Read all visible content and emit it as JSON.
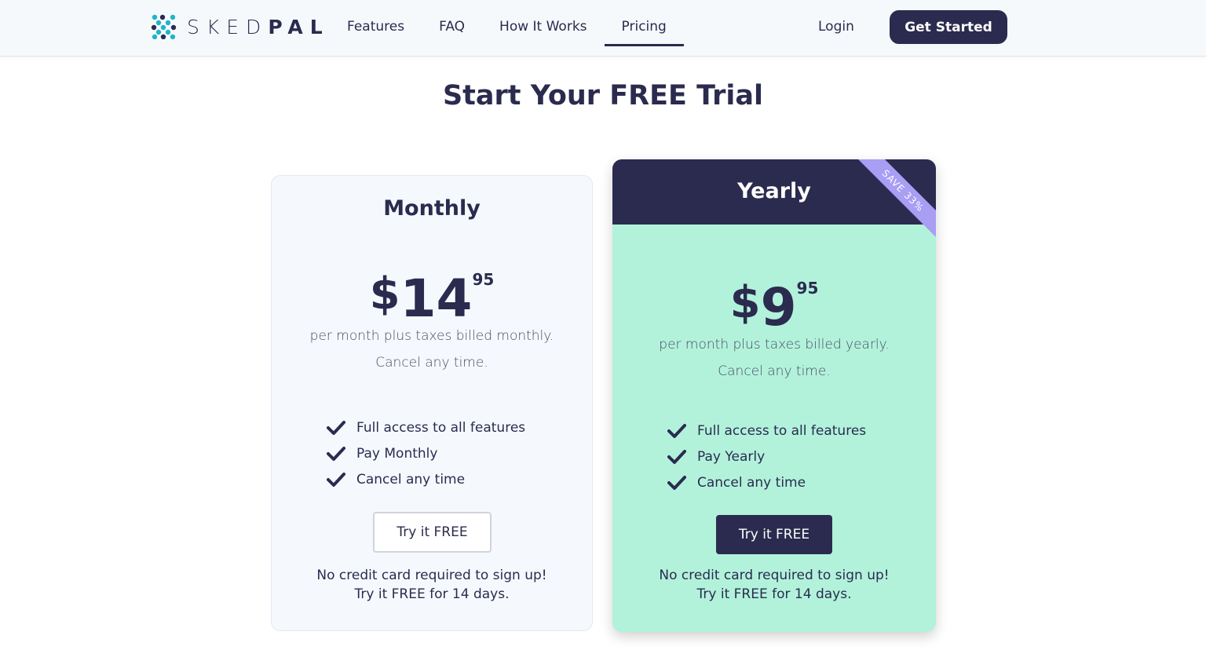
{
  "brand": {
    "logo_icon": "skedpal-dots-logo",
    "name_light": "SKED",
    "name_bold": "PAL"
  },
  "nav": {
    "items": [
      {
        "label": "Features"
      },
      {
        "label": "FAQ"
      },
      {
        "label": "How It Works"
      },
      {
        "label": "Pricing",
        "active": true
      }
    ],
    "login_label": "Login",
    "cta_label": "Get Started"
  },
  "heading": {
    "prefix": "Start Your ",
    "emphasis": "FREE Trial"
  },
  "plans": {
    "monthly": {
      "name": "Monthly",
      "currency": "$",
      "amount": "14",
      "cents": "95",
      "billing": "per month plus taxes billed monthly.",
      "cancel": "Cancel any time.",
      "features": [
        "Full access to all features",
        "Pay Monthly",
        "Cancel any time"
      ],
      "button_label": "Try it FREE",
      "note_line1": "No credit card required to sign up!",
      "note_line2": "Try it FREE for 14 days."
    },
    "yearly": {
      "name": "Yearly",
      "ribbon": "SAVE 33%",
      "currency": "$",
      "amount": "9",
      "cents": "95",
      "billing": "per month plus taxes billed yearly.",
      "cancel": "Cancel any time.",
      "features": [
        "Full access to all features",
        "Pay Yearly",
        "Cancel any time"
      ],
      "button_label": "Try it FREE",
      "note_line1": "No credit card required to sign up!",
      "note_line2": "Try it FREE for 14 days."
    }
  },
  "colors": {
    "primary": "#2b2b4f",
    "yearly_bg": "#b2f2db",
    "ribbon": "#a99df4",
    "logo_teal": "#1fb6c8",
    "logo_navy": "#2b2b4f"
  }
}
